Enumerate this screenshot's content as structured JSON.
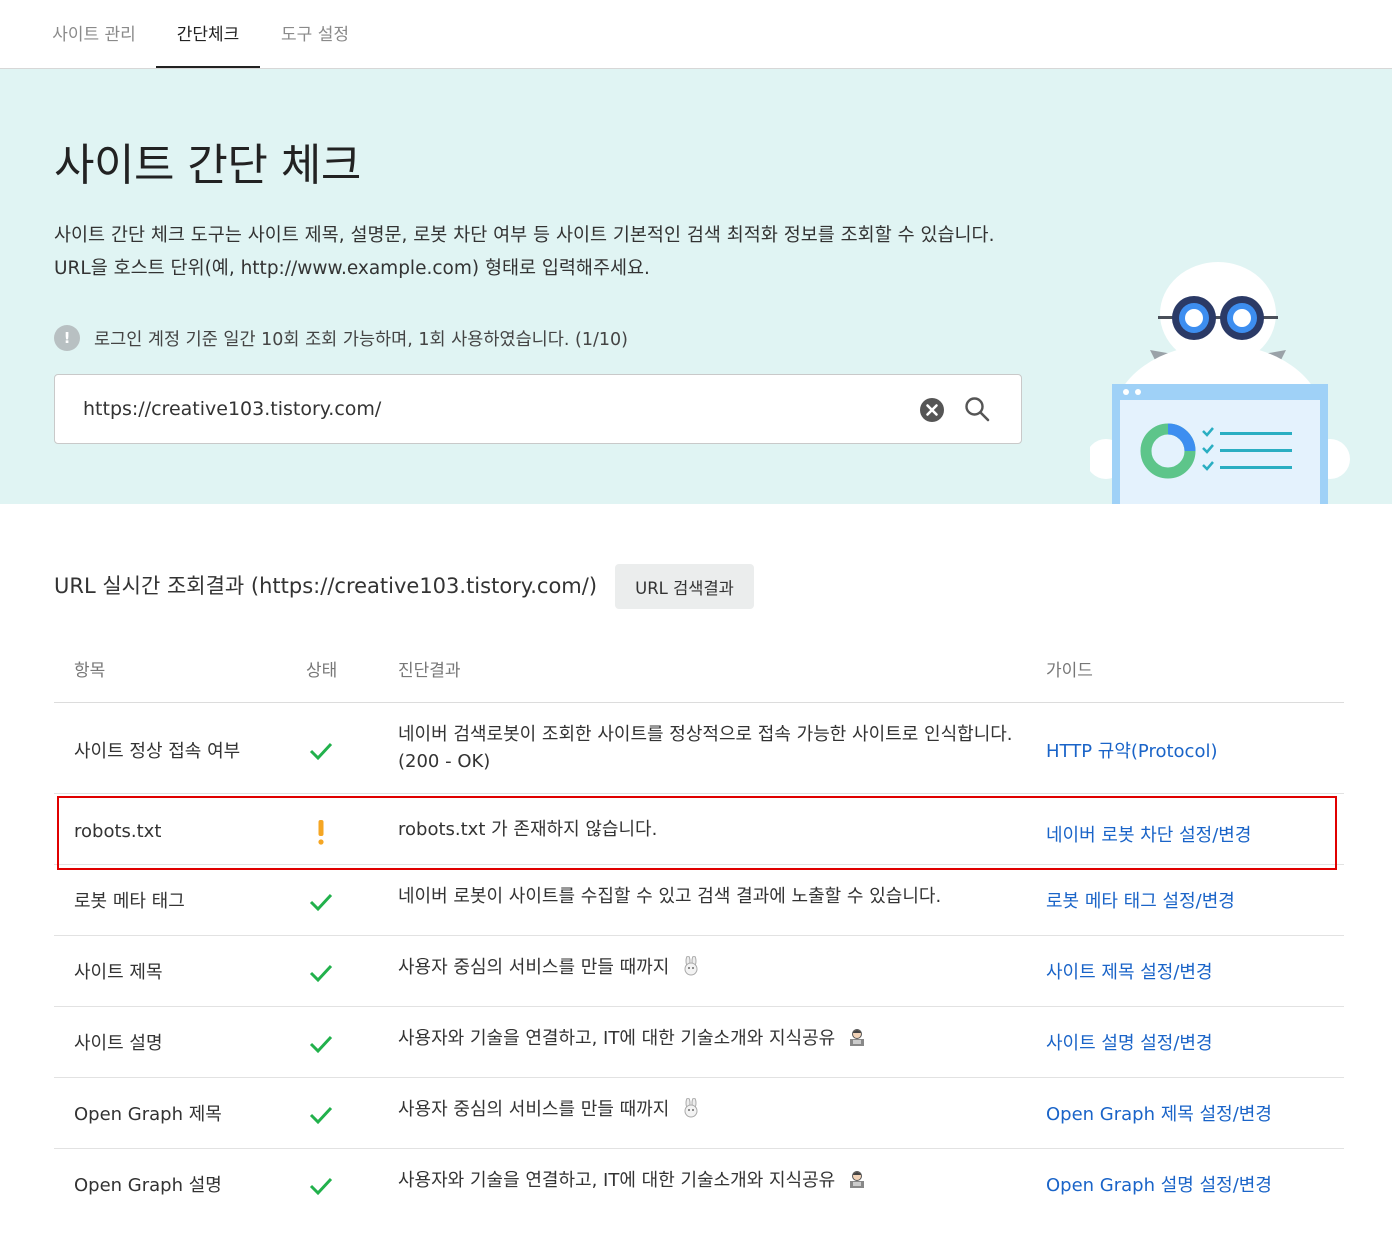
{
  "nav": {
    "tabs": [
      {
        "label": "사이트 관리",
        "active": false
      },
      {
        "label": "간단체크",
        "active": true
      },
      {
        "label": "도구 설정",
        "active": false
      }
    ]
  },
  "hero": {
    "title": "사이트 간단 체크",
    "desc_line1": "사이트 간단 체크 도구는 사이트 제목, 설명문, 로봇 차단 여부 등 사이트 기본적인 검색 최적화 정보를 조회할 수 있습니다.",
    "desc_line2": "URL을 호스트 단위(예, http://www.example.com) 형태로 입력해주세요.",
    "notice": "로그인 계정 기준 일간 10회 조회 가능하며, 1회 사용하였습니다. (1/10)",
    "notice_icon": "!",
    "search_value": "https://creative103.tistory.com/"
  },
  "results": {
    "title": "URL 실시간 조회결과 (https://creative103.tistory.com/)",
    "url_search_button": "URL 검색결과",
    "headers": {
      "item": "항목",
      "status": "상태",
      "result": "진단결과",
      "guide": "가이드"
    },
    "rows": [
      {
        "item": "사이트 정상 접속 여부",
        "status": "ok",
        "result_line1": "네이버 검색로봇이 조회한 사이트를 정상적으로 접속 가능한 사이트로 인식합니다.",
        "result_line2": "(200 - OK)",
        "guide": "HTTP 규약(Protocol)"
      },
      {
        "item": "robots.txt",
        "status": "warning",
        "result_line1": "robots.txt 가 존재하지 않습니다.",
        "guide": "네이버 로봇 차단 설정/변경"
      },
      {
        "item": "로봇 메타 태그",
        "status": "ok",
        "result_line1": "네이버 로봇이 사이트를 수집할 수 있고 검색 결과에 노출할 수 있습니다.",
        "guide": "로봇 메타 태그 설정/변경"
      },
      {
        "item": "사이트 제목",
        "status": "ok",
        "result_line1": "사용자 중심의 서비스를 만들 때까지",
        "emoji": "rabbit-icon",
        "guide": "사이트 제목 설정/변경"
      },
      {
        "item": "사이트 설명",
        "status": "ok",
        "result_line1": "사용자와 기술을 연결하고, IT에 대한 기술소개와 지식공유",
        "emoji": "technologist-icon",
        "guide": "사이트 설명 설정/변경"
      },
      {
        "item": "Open Graph 제목",
        "status": "ok",
        "result_line1": "사용자 중심의 서비스를 만들 때까지",
        "emoji": "rabbit-icon",
        "guide": "Open Graph 제목 설정/변경"
      },
      {
        "item": "Open Graph 설명",
        "status": "ok",
        "result_line1": "사용자와 기술을 연결하고, IT에 대한 기술소개와 지식공유",
        "emoji": "technologist-icon",
        "guide": "Open Graph 설명 설정/변경"
      }
    ]
  },
  "colors": {
    "hero_bg": "#e0f4f3",
    "ok_check": "#22b14c",
    "warning": "#f5a623",
    "link": "#1a64c8",
    "highlight_border": "#e00000"
  }
}
